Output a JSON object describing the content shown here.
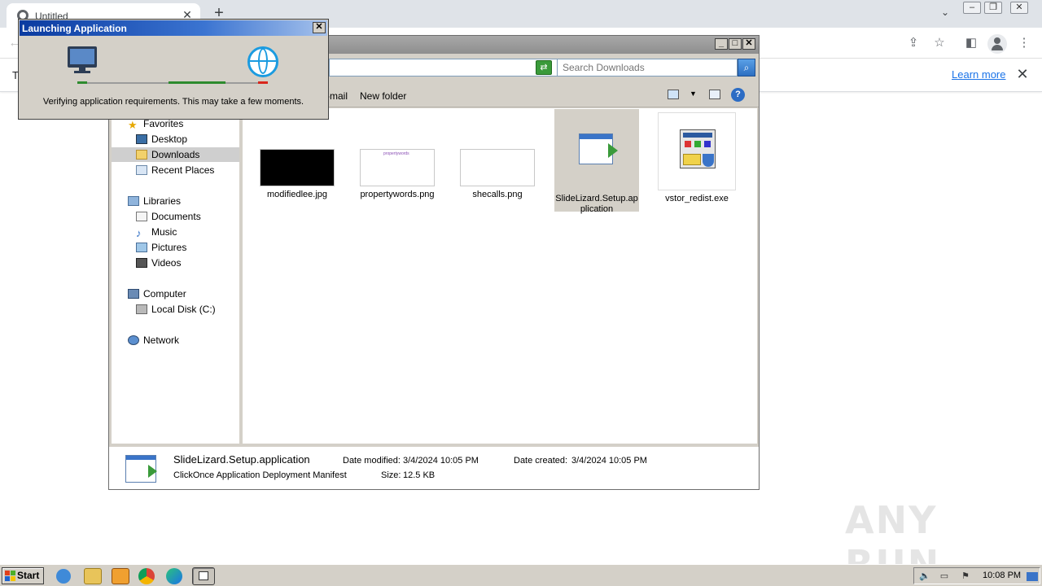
{
  "browser": {
    "tab_title": "Untitled",
    "infobar_text": "T",
    "learn_more": "Learn more"
  },
  "explorer": {
    "search_placeholder": "Search Downloads",
    "toolbar": {
      "email": "-mail",
      "new_folder": "New folder"
    },
    "nav": {
      "favorites": "Favorites",
      "desktop": "Desktop",
      "downloads": "Downloads",
      "recent": "Recent Places",
      "libraries": "Libraries",
      "documents": "Documents",
      "music": "Music",
      "pictures": "Pictures",
      "videos": "Videos",
      "computer": "Computer",
      "local_disk": "Local Disk (C:)",
      "network": "Network"
    },
    "files": [
      {
        "name": "modifiedlee.jpg"
      },
      {
        "name": "propertywords.png",
        "thumb_text": "propertywords"
      },
      {
        "name": "shecalls.png"
      },
      {
        "name": "SlideLizard.Setup.application"
      },
      {
        "name": "vstor_redist.exe"
      }
    ],
    "details": {
      "name": "SlideLizard.Setup.application",
      "type": "ClickOnce Application Deployment Manifest",
      "modified_label": "Date modified:",
      "modified_value": "3/4/2024 10:05 PM",
      "created_label": "Date created:",
      "created_value": "3/4/2024 10:05 PM",
      "size_label": "Size:",
      "size_value": "12.5 KB"
    }
  },
  "launch_dialog": {
    "title": "Launching Application",
    "message": "Verifying application requirements. This may take a few moments."
  },
  "watermark": "ANY RUN",
  "taskbar": {
    "start": "Start",
    "clock": "10:08 PM"
  },
  "colors": {
    "dialog_title_start": "#0a3aa0",
    "progress_green": "#2e8b2e",
    "progress_red": "#d9261c",
    "link_blue": "#1a73e8"
  }
}
